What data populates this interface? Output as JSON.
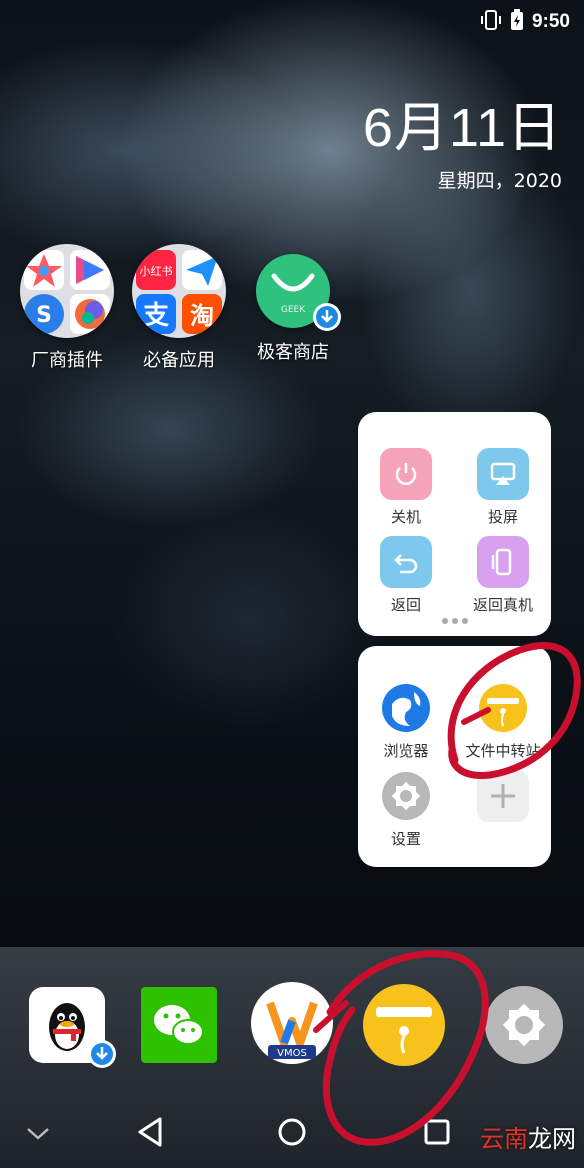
{
  "status_bar": {
    "time": "9:50"
  },
  "lockscreen": {
    "date": "6月11日",
    "weekday_year": "星期四，2020"
  },
  "home_apps": [
    {
      "label": "厂商插件"
    },
    {
      "label": "必备应用"
    },
    {
      "label": "极客商店",
      "icon_text": "GEEK"
    }
  ],
  "folder_tiles": {
    "xiaohongshu": "小红书",
    "alipay": "支",
    "taobao": "淘"
  },
  "quick_panel": {
    "items": [
      {
        "label": "关机",
        "icon": "power-icon",
        "color": "#f5a3b8"
      },
      {
        "label": "投屏",
        "icon": "cast-icon",
        "color": "#7ec8ee"
      },
      {
        "label": "返回",
        "icon": "back-arrow-icon",
        "color": "#7ec8ee"
      },
      {
        "label": "返回真机",
        "icon": "phone-icon",
        "color": "#d9a0f0"
      }
    ]
  },
  "app_panel": {
    "items": [
      {
        "label": "浏览器",
        "icon": "browser-icon"
      },
      {
        "label": "文件中转站",
        "icon": "file-transfer-icon"
      },
      {
        "label": "设置",
        "icon": "settings-icon"
      },
      {
        "label": "",
        "icon": "add-icon"
      }
    ]
  },
  "dock": {
    "apps": [
      {
        "name": "qq",
        "icon": "qq-penguin-icon"
      },
      {
        "name": "wechat",
        "icon": "wechat-icon"
      },
      {
        "name": "vmos",
        "icon": "vmos-icon",
        "badge": "VMOS"
      },
      {
        "name": "file-transfer",
        "icon": "file-transfer-icon"
      },
      {
        "name": "settings",
        "icon": "settings-icon"
      }
    ]
  },
  "watermark": {
    "red": "云南",
    "rest": "龙网"
  },
  "colors": {
    "annotation_red": "#c8102e",
    "geek_green": "#2ec27e",
    "file_yellow": "#f7c21c"
  }
}
